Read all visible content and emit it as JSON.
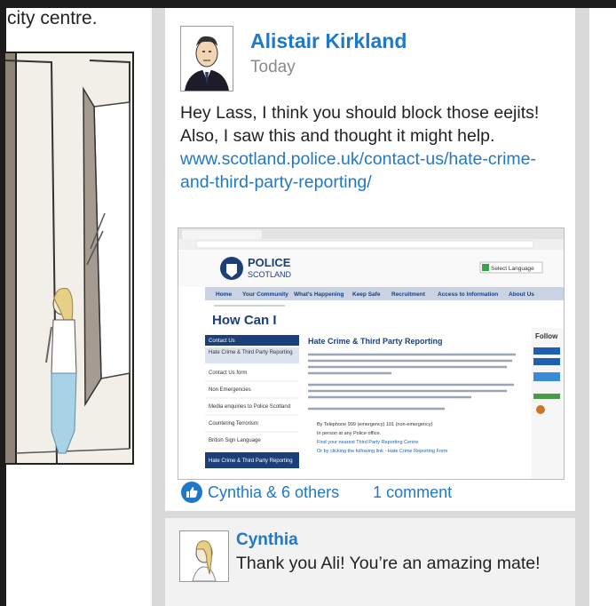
{
  "comic": {
    "caption_fragment": "city centre."
  },
  "post": {
    "author": "Alistair Kirkland",
    "time": "Today",
    "message": "Hey Lass, I think you should block those eejits! Also, I saw this and thought it might help.",
    "link": "www.scotland.police.uk/contact-us/hate-crime-and-third-party-reporting/",
    "likes_text": "Cynthia & 6 others",
    "comments_text": "1 comment"
  },
  "screenshot": {
    "brand_line1": "POLICE",
    "brand_line2": "SCOTLAND",
    "select_language": "Select Language",
    "nav": [
      "Home",
      "Your Community",
      "What's Happening",
      "Keep Safe",
      "Recruitment",
      "Access to Information",
      "About Us"
    ],
    "heading": "How Can I",
    "sidebar": [
      "Contact Us",
      "Hate Crime & Third Party Reporting",
      "Contact Us form",
      "Non Emergencies",
      "Media enquiries to Police Scotland",
      "Countering Terrorism",
      "British Sign Language",
      "Hate Crime & Third Party Reporting"
    ],
    "article_title": "Hate Crime & Third Party Reporting",
    "bullets": [
      "By Telephone 999 (emergency) 101 (non-emergency)",
      "In person at any Police office.",
      "Find your nearest Third Party Reporting Centre",
      "Or by clicking the following link - Hate Crime Reporting Form"
    ],
    "follow": "Follow"
  },
  "comment": {
    "author": "Cynthia",
    "text": "Thank you Ali! You’re an amazing mate!"
  },
  "colors": {
    "accent": "#1f78c8",
    "gutter": "#d9d9d9",
    "comment_bg": "#f2f2f2"
  }
}
